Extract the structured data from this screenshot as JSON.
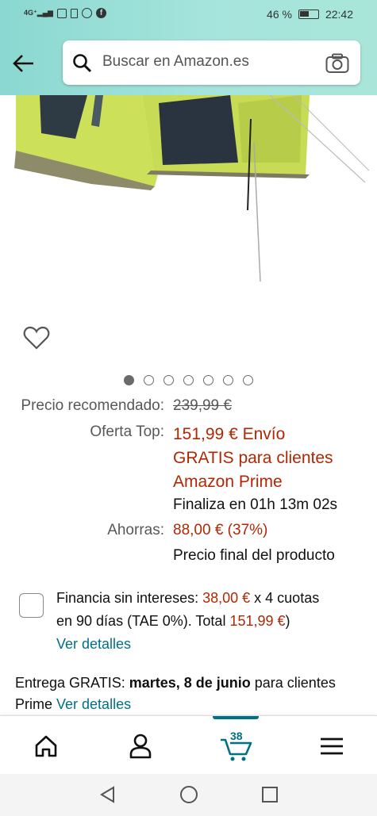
{
  "status_bar": {
    "battery": "46 %",
    "time": "22:42"
  },
  "search": {
    "placeholder": "Buscar en Amazon.es"
  },
  "price": {
    "recommended_label": "Precio recomendado:",
    "recommended_value": "239,99 €",
    "top_offer_label": "Oferta Top:",
    "top_offer_line1": "151,99 € Envío",
    "top_offer_line2": "GRATIS para clientes",
    "top_offer_line3": "Amazon Prime",
    "ends_in": "Finaliza en 01h 13m 02s",
    "savings_label": "Ahorras:",
    "savings_value": "88,00 € (37%)",
    "final_price_note": "Precio final del producto"
  },
  "financing": {
    "text_part1": "Financia sin intereses: ",
    "installment": "38,00 €",
    "text_part2": " x 4 cuotas",
    "text_part3": "en 90 días (TAE 0%). Total ",
    "total": "151,99 €",
    "text_part4": ")",
    "details_link": "Ver detalles"
  },
  "delivery": {
    "prefix": "Entrega GRATIS: ",
    "date": "martes, 8 de junio",
    "suffix": " para clientes",
    "suffix2": "Prime ",
    "details_link": "Ver detalles"
  },
  "image_carousel": {
    "total_dots": 7,
    "active_index": 0
  },
  "bottom_nav": {
    "cart_count": "38",
    "items": [
      "home-icon",
      "account-icon",
      "cart-icon",
      "menu-icon"
    ]
  },
  "colors": {
    "header_gradient_start": "#8ad8d1",
    "price_red": "#b12704",
    "link_teal": "#007185"
  }
}
